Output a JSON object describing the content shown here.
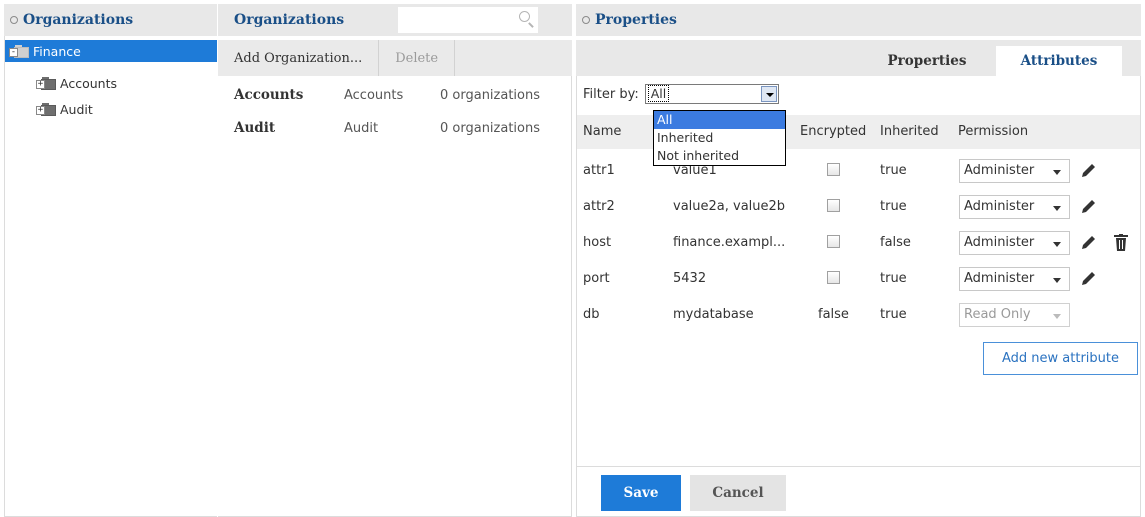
{
  "left_panel": {
    "title": "Organizations",
    "tree": [
      {
        "label": "Finance",
        "selected": true
      },
      {
        "label": "Accounts",
        "selected": false
      },
      {
        "label": "Audit",
        "selected": false
      }
    ]
  },
  "middle_panel": {
    "title": "Organizations",
    "search_placeholder": "",
    "toolbar": {
      "add_label": "Add Organization...",
      "delete_label": "Delete"
    },
    "rows": [
      {
        "name": "Accounts",
        "description": "Accounts",
        "count": "0 organizations"
      },
      {
        "name": "Audit",
        "description": "Audit",
        "count": "0 organizations"
      }
    ]
  },
  "right_panel": {
    "title": "Properties",
    "tabs": [
      {
        "label": "Properties",
        "active": false
      },
      {
        "label": "Attributes",
        "active": true
      }
    ],
    "filter": {
      "label": "Filter by:",
      "selected": "All",
      "options": [
        "All",
        "Inherited",
        "Not inherited"
      ],
      "highlighted": "All"
    },
    "columns": {
      "name": "Name",
      "encrypted": "Encrypted",
      "inherited": "Inherited",
      "permission": "Permission"
    },
    "attributes": [
      {
        "name": "attr1",
        "value": "value1",
        "encrypted": "",
        "inherited": "true",
        "permission": "Administer",
        "editable": true,
        "deletable": false
      },
      {
        "name": "attr2",
        "value": "value2a, value2b",
        "encrypted": "",
        "inherited": "true",
        "permission": "Administer",
        "editable": true,
        "deletable": false
      },
      {
        "name": "host",
        "value": "finance.exampl...",
        "encrypted": "",
        "inherited": "false",
        "permission": "Administer",
        "editable": true,
        "deletable": true
      },
      {
        "name": "port",
        "value": "5432",
        "encrypted": "",
        "inherited": "true",
        "permission": "Administer",
        "editable": true,
        "deletable": false
      },
      {
        "name": "db",
        "value": "mydatabase",
        "encrypted": "false",
        "inherited": "true",
        "permission": "Read Only",
        "editable": false,
        "deletable": false
      }
    ],
    "add_attribute_label": "Add new attribute",
    "save_label": "Save",
    "cancel_label": "Cancel"
  },
  "colors": {
    "accent": "#1e7bd8",
    "title_blue": "#1a4f87",
    "header_gray": "#e8e8e8",
    "highlight": "#3b7be0"
  }
}
